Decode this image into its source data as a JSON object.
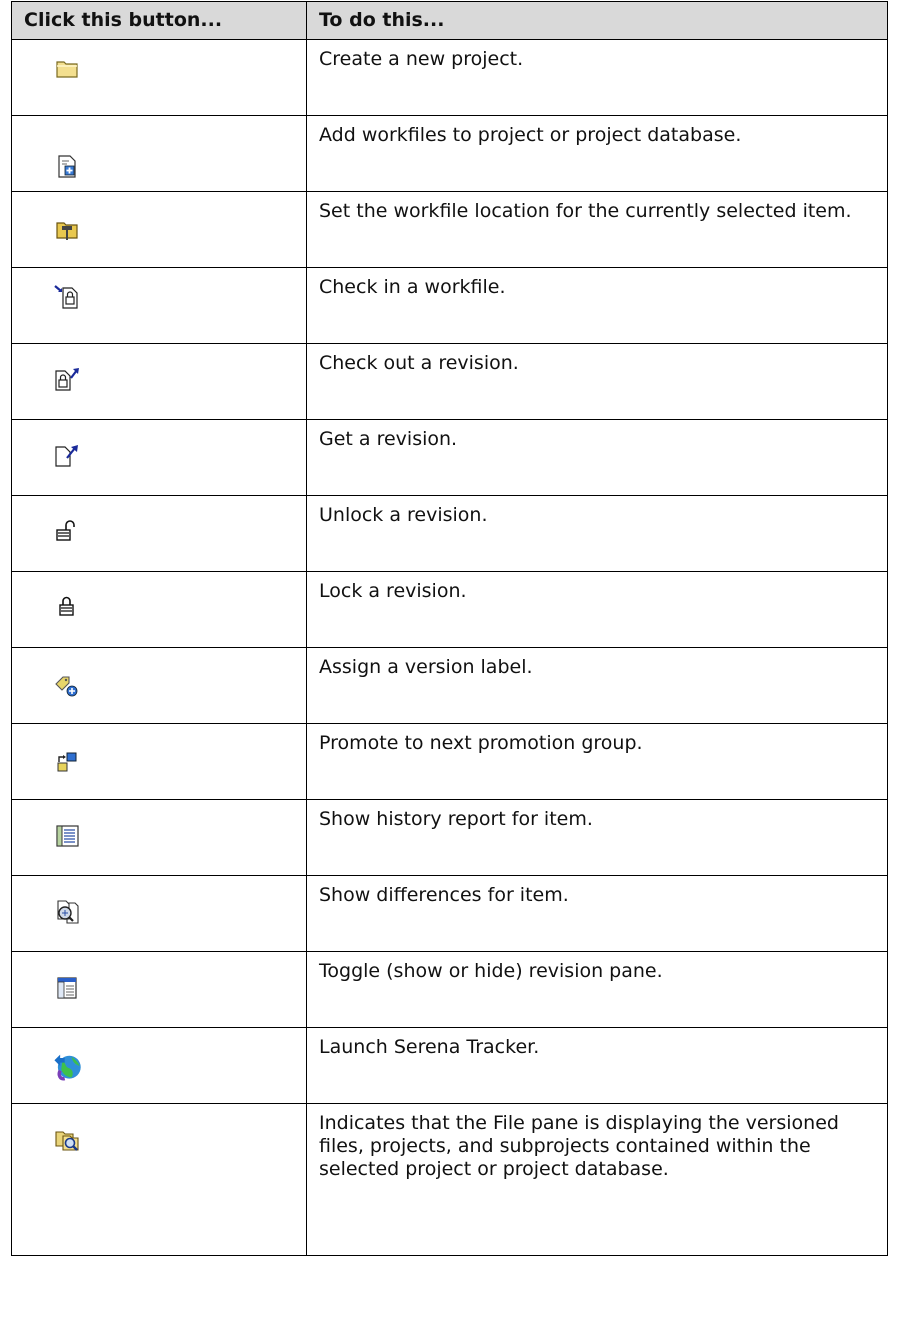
{
  "table": {
    "headers": [
      "Click this button...",
      "To do this..."
    ],
    "rows": [
      {
        "icon": "new-project-folder-icon",
        "description": "Create a new project."
      },
      {
        "icon": "add-workfiles-icon",
        "description": "Add workfiles to project or project database."
      },
      {
        "icon": "workfile-location-icon",
        "description": "Set the workfile location for the currently selected item."
      },
      {
        "icon": "check-in-icon",
        "description": "Check in a workfile."
      },
      {
        "icon": "check-out-icon",
        "description": "Check out a revision."
      },
      {
        "icon": "get-revision-icon",
        "description": "Get a revision."
      },
      {
        "icon": "unlock-icon",
        "description": "Unlock a revision."
      },
      {
        "icon": "lock-icon",
        "description": "Lock a revision."
      },
      {
        "icon": "version-label-icon",
        "description": "Assign a version label."
      },
      {
        "icon": "promote-icon",
        "description": "Promote to next promotion group."
      },
      {
        "icon": "history-report-icon",
        "description": "Show history report for item."
      },
      {
        "icon": "differences-icon",
        "description": "Show differences for item."
      },
      {
        "icon": "revision-pane-toggle-icon",
        "description": "Toggle (show or hide) revision pane."
      },
      {
        "icon": "serena-tracker-icon",
        "description": "Launch Serena Tracker."
      },
      {
        "icon": "file-pane-view-icon",
        "description": "Indicates that the File pane is displaying the versioned files, projects, and subprojects contained within the selected project or project database."
      }
    ]
  }
}
